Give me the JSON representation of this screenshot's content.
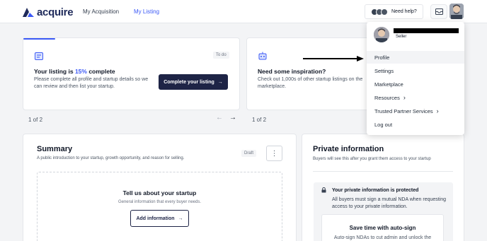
{
  "brand": {
    "name": "acquire",
    "color": "#3b59f6"
  },
  "nav": {
    "items": [
      "My Acquisition",
      "My Listing"
    ],
    "active": "My Listing"
  },
  "header": {
    "help_label": "Need help?",
    "inbox_icon": "mail-icon"
  },
  "listing_card": {
    "badge": "To do",
    "title_prefix": "Your listing is ",
    "title_percent": "15%",
    "title_suffix": " complete",
    "progress": 0.15,
    "description": "Please complete all profile and startup details so we can review and then list your startup.",
    "button_label": "Complete your listing",
    "pager": "1 of 2"
  },
  "inspiration_card": {
    "title": "Need some inspiration?",
    "description": "Check out 1,000s of other startup listings on the marketplace.",
    "pager": "1 of 2"
  },
  "summary": {
    "title": "Summary",
    "subtitle": "A public introduction to your startup, growth opportunity, and reason for selling.",
    "badge": "Draft",
    "empty_title": "Tell us about your startup",
    "empty_sub": "General information that every buyer needs.",
    "button_label": "Add information"
  },
  "private_info": {
    "title": "Private information",
    "subtitle": "Buyers will see this after you grant them access to your startup",
    "protected_title": "Your private information is protected",
    "protected_text": "All buyers must sign a mutual NDA when requesting access to your private information.",
    "autosign_title": "Save time with auto-sign",
    "autosign_text": "Auto-sign NDAs to cut admin and unlock the"
  },
  "account_menu": {
    "role": "Seller",
    "items": [
      "Profile",
      "Settings",
      "Marketplace",
      "Resources",
      "Trusted Partner Services",
      "Log out"
    ],
    "highlighted": "Profile"
  }
}
